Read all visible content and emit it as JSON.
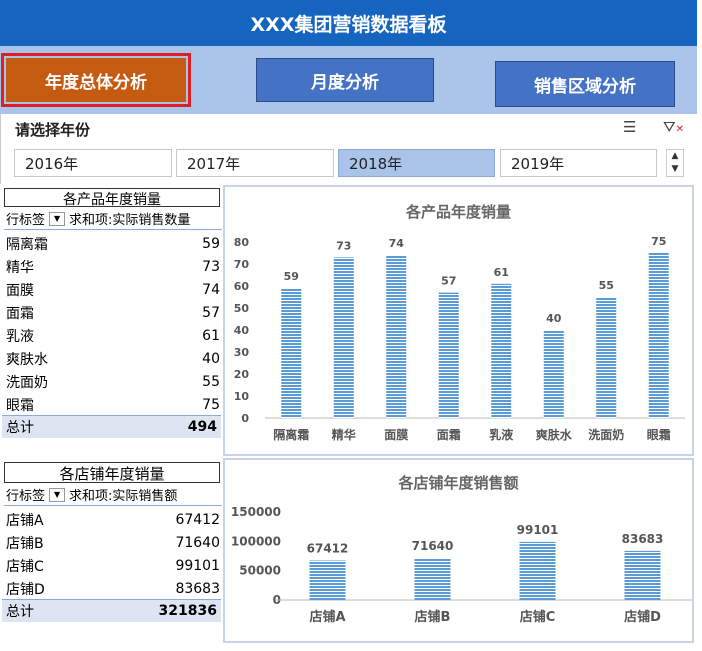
{
  "app": {
    "title": "XXX集团营销数据看板"
  },
  "nav": [
    {
      "label": "年度总体分析",
      "active": true
    },
    {
      "label": "月度分析",
      "active": false
    },
    {
      "label": "销售区域分析",
      "active": false
    }
  ],
  "slicer": {
    "title": "请选择年份",
    "multi_select_icon": "multi-select-icon",
    "clear_filter_icon": "clear-filter-icon",
    "years": [
      {
        "label": "2016年",
        "selected": false
      },
      {
        "label": "2017年",
        "selected": false
      },
      {
        "label": "2018年",
        "selected": true
      },
      {
        "label": "2019年",
        "selected": false
      }
    ],
    "scroll_up": "▲",
    "scroll_down": "▼"
  },
  "product_pivot": {
    "title": "各产品年度销量",
    "row_label": "行标签",
    "value_label": "求和项:实际销售数量",
    "rows": [
      {
        "name": "隔离霜",
        "value": 59
      },
      {
        "name": "精华",
        "value": 73
      },
      {
        "name": "面膜",
        "value": 74
      },
      {
        "name": "面霜",
        "value": 57
      },
      {
        "name": "乳液",
        "value": 61
      },
      {
        "name": "爽肤水",
        "value": 40
      },
      {
        "name": "洗面奶",
        "value": 55
      },
      {
        "name": "眼霜",
        "value": 75
      }
    ],
    "total_label": "总计",
    "total": 494
  },
  "store_pivot": {
    "title": "各店铺年度销量",
    "row_label": "行标签",
    "value_label": "求和项:实际销售额",
    "rows": [
      {
        "name": "店铺A",
        "value": 67412
      },
      {
        "name": "店铺B",
        "value": 71640
      },
      {
        "name": "店铺C",
        "value": 99101
      },
      {
        "name": "店铺D",
        "value": 83683
      }
    ],
    "total_label": "总计",
    "total": 321836
  },
  "chart_data": [
    {
      "type": "bar",
      "title": "各产品年度销量",
      "categories": [
        "隔离霜",
        "精华",
        "面膜",
        "面霜",
        "乳液",
        "爽肤水",
        "洗面奶",
        "眼霜"
      ],
      "values": [
        59,
        73,
        74,
        57,
        61,
        40,
        55,
        75
      ],
      "ylim": [
        0,
        80
      ],
      "yticks": [
        0,
        10,
        20,
        30,
        40,
        50,
        60,
        70,
        80
      ],
      "bar_color": "#5b9bd5"
    },
    {
      "type": "bar",
      "title": "各店铺年度销售额",
      "categories": [
        "店铺A",
        "店铺B",
        "店铺C",
        "店铺D"
      ],
      "values": [
        67412,
        71640,
        99101,
        83683
      ],
      "ylim": [
        0,
        150000
      ],
      "yticks": [
        0,
        50000,
        100000,
        150000
      ],
      "bar_color": "#5b9bd5"
    }
  ]
}
